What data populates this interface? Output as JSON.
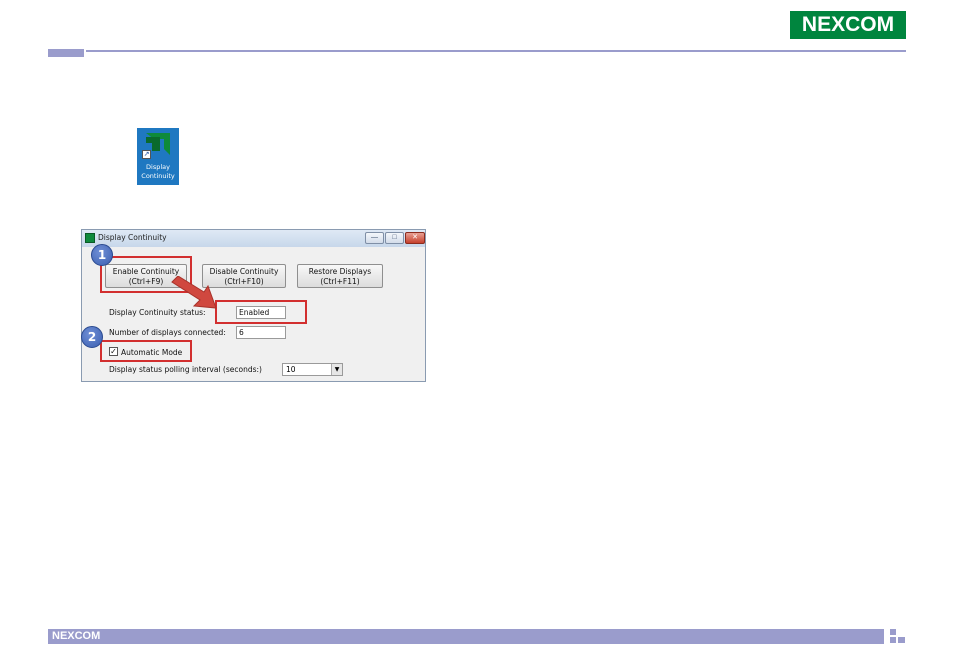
{
  "header": {
    "logo": "NEXCOM"
  },
  "desktop_icon": {
    "label_line1": "Display",
    "label_line2": "Continuity",
    "icon": "amd-arrow-icon"
  },
  "window": {
    "title": "Display Continuity",
    "controls": {
      "minimize": "—",
      "maximize": "□",
      "close": "✕"
    },
    "buttons": {
      "enable": {
        "line1": "Enable Continuity",
        "line2": "(Ctrl+F9)"
      },
      "disable": {
        "line1": "Disable Continuity",
        "line2": "(Ctrl+F10)"
      },
      "restore": {
        "line1": "Restore Displays",
        "line2": "(Ctrl+F11)"
      }
    },
    "status_label": "Display Continuity status:",
    "status_value": "Enabled",
    "displays_label": "Number of displays connected:",
    "displays_value": "6",
    "automatic_mode_label": "Automatic Mode",
    "automatic_mode_checked": true,
    "check_mark": "✓",
    "polling_label": "Display status polling interval (seconds:)",
    "polling_value": "10",
    "dropdown_arrow": "▼"
  },
  "annotations": {
    "step1": "1",
    "step2": "2",
    "highlight_color": "#d22f2f",
    "badge_color": "#3b5fb0"
  },
  "footer": {
    "logo": "NEXCOM"
  },
  "colors": {
    "brand_green": "#00853e",
    "accent_lavender": "#9a9ccc"
  }
}
